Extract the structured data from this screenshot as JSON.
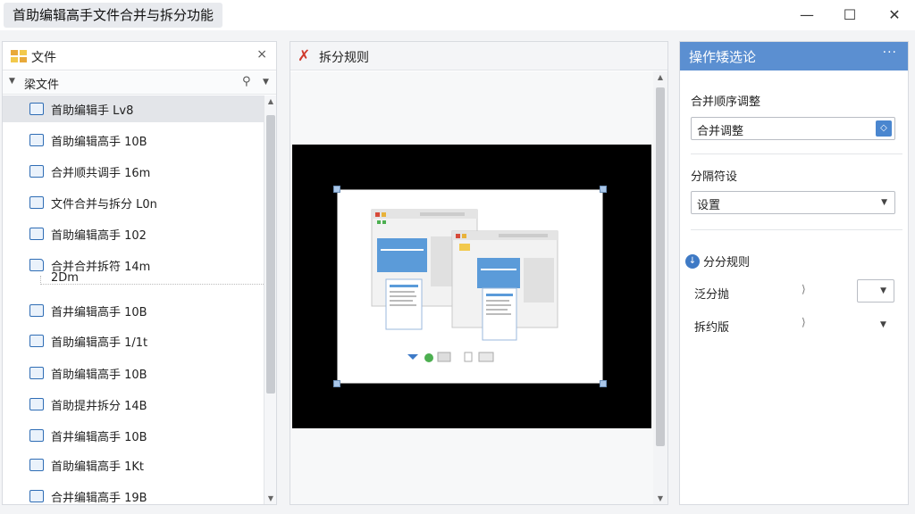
{
  "window": {
    "title": "首助编辑高手文件合并与拆分功能",
    "minimize_glyph": "—",
    "maximize_glyph": "☐",
    "close_glyph": "✕"
  },
  "file_panel": {
    "title": "文件",
    "close_glyph": "×",
    "subheader": "梁文件",
    "files": [
      {
        "name": "首助编辑手 Lv8",
        "selected": true,
        "icon": "file-icon"
      },
      {
        "name": "首助编辑高手 10B",
        "icon": "file-icon"
      },
      {
        "name": "合并顺共调手 16m",
        "icon": "list-icon"
      },
      {
        "name": "文件合并与拆分 L0n",
        "icon": "comment-icon"
      },
      {
        "name": "首助编辑高手 102",
        "icon": "file-icon"
      },
      {
        "name": "合并合并拆符 14m",
        "name_line2": "2Dm",
        "icon": "folder-icon"
      },
      {
        "name": "首井编辑高手 10B",
        "icon": "file-icon"
      },
      {
        "name": "首助编辑高手 1/1t",
        "icon": "file-icon"
      },
      {
        "name": "首助编辑高手 10B",
        "icon": "file-icon"
      },
      {
        "name": "首助提井拆分 14B",
        "icon": "file-icon"
      },
      {
        "name": "首井编辑高手 10B",
        "icon": "file-icon"
      },
      {
        "name": "首助编辑高手 1Kt",
        "icon": "file-icon"
      },
      {
        "name": "合井编辑高手 19B",
        "icon": "file-icon"
      }
    ]
  },
  "preview_panel": {
    "title": "拆分规则"
  },
  "settings_panel": {
    "title": "操作矮选论",
    "more_glyph": "···",
    "merge_order": {
      "label": "合并顺序调整",
      "value": "合并调整"
    },
    "separator": {
      "label": "分隔符设",
      "value": "设置"
    },
    "split_rules": {
      "label": "分分规则",
      "rows": [
        {
          "label": "泛分抛",
          "mark": "⟩"
        },
        {
          "label": "拆约版",
          "mark": "⟩"
        }
      ]
    }
  }
}
